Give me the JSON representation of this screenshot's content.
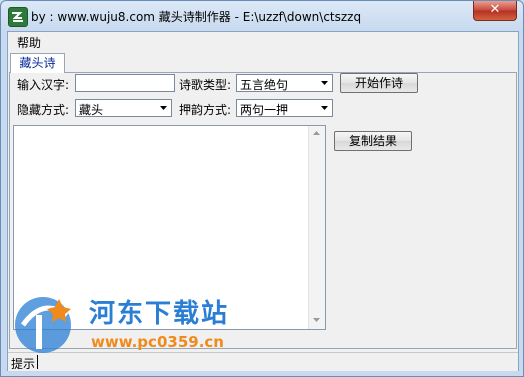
{
  "window": {
    "title": "by : www.wuju8.com   藏头诗制作器 - E:\\uzzf\\down\\ctszzq",
    "close_label": "✕"
  },
  "menu": {
    "items": [
      "帮助"
    ]
  },
  "tabs": [
    {
      "label": "藏头诗",
      "active": true
    }
  ],
  "form": {
    "input_label": "输入汉字:",
    "input_value": "",
    "poem_type_label": "诗歌类型:",
    "poem_type_value": "五言绝句",
    "start_button": "开始作诗",
    "hide_mode_label": "隐藏方式:",
    "hide_mode_value": "藏头",
    "rhyme_label": "押韵方式:",
    "rhyme_value": "两句一押",
    "copy_button": "复制结果",
    "result_text": ""
  },
  "status": {
    "text": "提示"
  },
  "watermark": {
    "title": "河东下载站",
    "url": "www.pc0359.cn"
  },
  "colors": {
    "accent": "#2a7fd4",
    "watermark_orange": "#f08a1c",
    "tab_text": "#0a2a9c"
  }
}
